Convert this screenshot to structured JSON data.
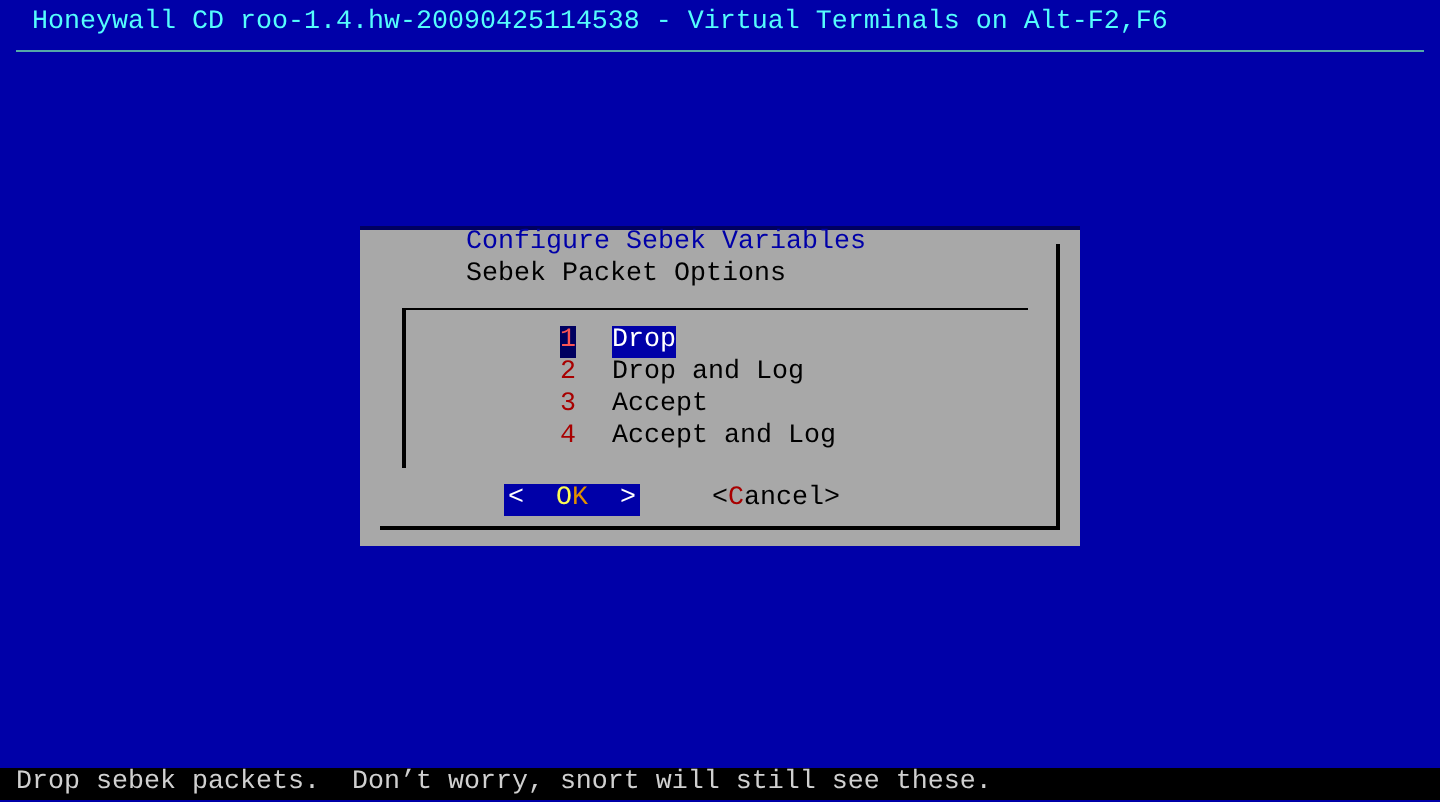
{
  "header": {
    "title": "Honeywall CD roo-1.4.hw-20090425114538 - Virtual Terminals on Alt-F2,F6"
  },
  "dialog": {
    "title": "Configure Sebek Variables",
    "prompt": "Sebek Packet Options",
    "items": [
      {
        "key": "1",
        "label": "Drop",
        "selected": true
      },
      {
        "key": "2",
        "label": "Drop and Log",
        "selected": false
      },
      {
        "key": "3",
        "label": "Accept",
        "selected": false
      },
      {
        "key": "4",
        "label": "Accept and Log",
        "selected": false
      }
    ],
    "buttons": [
      {
        "open": "<",
        "hotkey": "O",
        "rest": "K",
        "close": ">",
        "selected": true
      },
      {
        "open": "<",
        "hotkey": "C",
        "rest": "ancel",
        "close": ">",
        "selected": false
      }
    ]
  },
  "status_bar": {
    "text": "Drop sebek packets.  Don’t worry, snort will still see these."
  }
}
